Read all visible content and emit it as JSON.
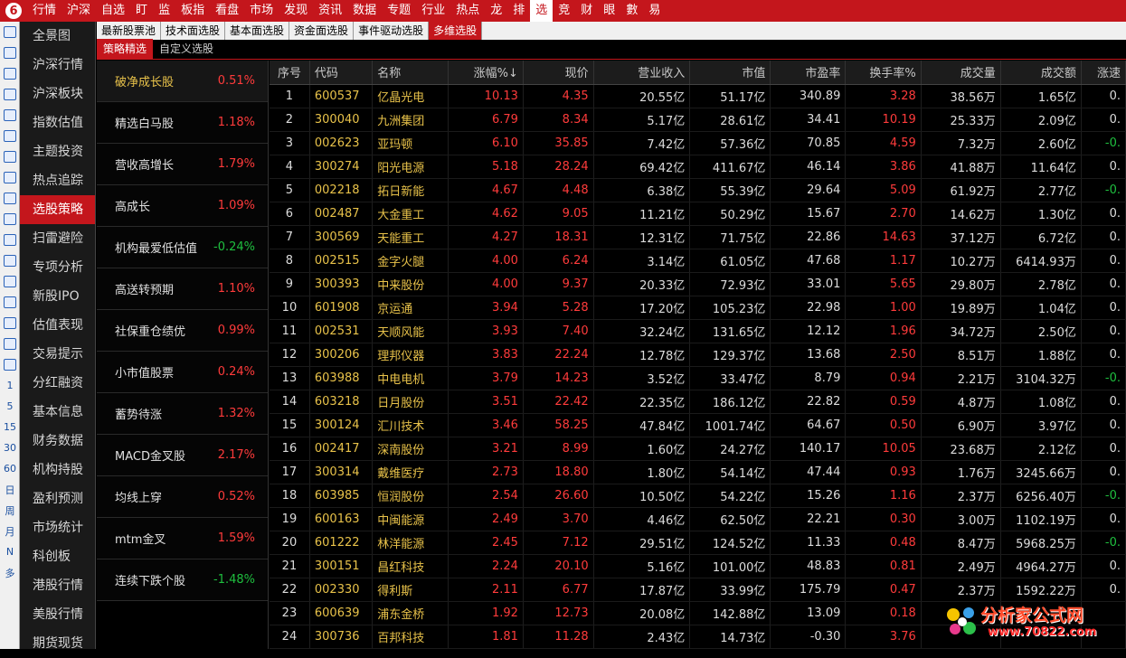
{
  "topnav": [
    "行情",
    "沪深",
    "自选",
    "盯",
    "监",
    "板指",
    "看盘",
    "市场",
    "发现",
    "资讯",
    "数据",
    "专题",
    "行业",
    "热点",
    "龙",
    "排",
    "选",
    "竞",
    "财",
    "眼",
    "數",
    "易"
  ],
  "topnav_active": 16,
  "left_icons": [
    "back-icon",
    "up-icon",
    "down-icon",
    "report-icon",
    "grid-icon",
    "chart-line-icon",
    "kline-icon",
    "fund-icon",
    "f10-icon",
    "news-icon",
    "f11-icon",
    "target-icon",
    "list-icon",
    "sort-icon",
    "export-icon",
    "pen-icon",
    "refresh-icon",
    "1",
    "5",
    "15",
    "30",
    "60",
    "日",
    "周",
    "月",
    "N",
    "多"
  ],
  "leftnav": [
    "全景图",
    "沪深行情",
    "沪深板块",
    "指数估值",
    "主题投资",
    "热点追踪",
    "选股策略",
    "扫雷避险",
    "专项分析",
    "新股IPO",
    "估值表现",
    "交易提示",
    "分红融资",
    "基本信息",
    "财务数据",
    "机构持股",
    "盈利预测",
    "市场统计",
    "科创板",
    "港股行情",
    "美股行情",
    "期货现货"
  ],
  "leftnav_active": 6,
  "subtabs1": [
    "最新股票池",
    "技术面选股",
    "基本面选股",
    "资金面选股",
    "事件驱动选股",
    "多维选股"
  ],
  "subtabs1_active": 5,
  "subtabs2": [
    "策略精选",
    "自定义选股"
  ],
  "subtabs2_active": 0,
  "strategies": [
    {
      "name": "破净成长股",
      "pct": "0.51%",
      "dir": "up"
    },
    {
      "name": "精选白马股",
      "pct": "1.18%",
      "dir": "up"
    },
    {
      "name": "营收高增长",
      "pct": "1.79%",
      "dir": "up"
    },
    {
      "name": "高成长",
      "pct": "1.09%",
      "dir": "up"
    },
    {
      "name": "机构最爱低估值",
      "pct": "-0.24%",
      "dir": "down"
    },
    {
      "name": "高送转预期",
      "pct": "1.10%",
      "dir": "up"
    },
    {
      "name": "社保重仓绩优",
      "pct": "0.99%",
      "dir": "up"
    },
    {
      "name": "小市值股票",
      "pct": "0.24%",
      "dir": "up"
    },
    {
      "name": "蓄势待涨",
      "pct": "1.32%",
      "dir": "up"
    },
    {
      "name": "MACD金叉股",
      "pct": "2.17%",
      "dir": "up"
    },
    {
      "name": "均线上穿",
      "pct": "0.52%",
      "dir": "up"
    },
    {
      "name": "mtm金叉",
      "pct": "1.59%",
      "dir": "up"
    },
    {
      "name": "连续下跌个股",
      "pct": "-1.48%",
      "dir": "down"
    }
  ],
  "strategies_active": 0,
  "table": {
    "headers": [
      "序号",
      "代码",
      "名称",
      "涨幅%↓",
      "现价",
      "营业收入",
      "市值",
      "市盈率",
      "换手率%",
      "成交量",
      "成交额",
      "涨速"
    ],
    "rows": [
      [
        "1",
        "600537",
        "亿晶光电",
        "10.13",
        "4.35",
        "20.55亿",
        "51.17亿",
        "340.89",
        "3.28",
        "38.56万",
        "1.65亿",
        "0."
      ],
      [
        "2",
        "300040",
        "九洲集团",
        "6.79",
        "8.34",
        "5.17亿",
        "28.61亿",
        "34.41",
        "10.19",
        "25.33万",
        "2.09亿",
        "0."
      ],
      [
        "3",
        "002623",
        "亚玛顿",
        "6.10",
        "35.85",
        "7.42亿",
        "57.36亿",
        "70.85",
        "4.59",
        "7.32万",
        "2.60亿",
        "-0."
      ],
      [
        "4",
        "300274",
        "阳光电源",
        "5.18",
        "28.24",
        "69.42亿",
        "411.67亿",
        "46.14",
        "3.86",
        "41.88万",
        "11.64亿",
        "0."
      ],
      [
        "5",
        "002218",
        "拓日新能",
        "4.67",
        "4.48",
        "6.38亿",
        "55.39亿",
        "29.64",
        "5.09",
        "61.92万",
        "2.77亿",
        "-0."
      ],
      [
        "6",
        "002487",
        "大金重工",
        "4.62",
        "9.05",
        "11.21亿",
        "50.29亿",
        "15.67",
        "2.70",
        "14.62万",
        "1.30亿",
        "0."
      ],
      [
        "7",
        "300569",
        "天能重工",
        "4.27",
        "18.31",
        "12.31亿",
        "71.75亿",
        "22.86",
        "14.63",
        "37.12万",
        "6.72亿",
        "0."
      ],
      [
        "8",
        "002515",
        "金字火腿",
        "4.00",
        "6.24",
        "3.14亿",
        "61.05亿",
        "47.68",
        "1.17",
        "10.27万",
        "6414.93万",
        "0."
      ],
      [
        "9",
        "300393",
        "中来股份",
        "4.00",
        "9.37",
        "20.33亿",
        "72.93亿",
        "33.01",
        "5.65",
        "29.80万",
        "2.78亿",
        "0."
      ],
      [
        "10",
        "601908",
        "京运通",
        "3.94",
        "5.28",
        "17.20亿",
        "105.23亿",
        "22.98",
        "1.00",
        "19.89万",
        "1.04亿",
        "0."
      ],
      [
        "11",
        "002531",
        "天顺风能",
        "3.93",
        "7.40",
        "32.24亿",
        "131.65亿",
        "12.12",
        "1.96",
        "34.72万",
        "2.50亿",
        "0."
      ],
      [
        "12",
        "300206",
        "理邦仪器",
        "3.83",
        "22.24",
        "12.78亿",
        "129.37亿",
        "13.68",
        "2.50",
        "8.51万",
        "1.88亿",
        "0."
      ],
      [
        "13",
        "603988",
        "中电电机",
        "3.79",
        "14.23",
        "3.52亿",
        "33.47亿",
        "8.79",
        "0.94",
        "2.21万",
        "3104.32万",
        "-0."
      ],
      [
        "14",
        "603218",
        "日月股份",
        "3.51",
        "22.42",
        "22.35亿",
        "186.12亿",
        "22.82",
        "0.59",
        "4.87万",
        "1.08亿",
        "0."
      ],
      [
        "15",
        "300124",
        "汇川技术",
        "3.46",
        "58.25",
        "47.84亿",
        "1001.74亿",
        "64.67",
        "0.50",
        "6.90万",
        "3.97亿",
        "0."
      ],
      [
        "16",
        "002417",
        "深南股份",
        "3.21",
        "8.99",
        "1.60亿",
        "24.27亿",
        "140.17",
        "10.05",
        "23.68万",
        "2.12亿",
        "0."
      ],
      [
        "17",
        "300314",
        "戴维医疗",
        "2.73",
        "18.80",
        "1.80亿",
        "54.14亿",
        "47.44",
        "0.93",
        "1.76万",
        "3245.66万",
        "0."
      ],
      [
        "18",
        "603985",
        "恒润股份",
        "2.54",
        "26.60",
        "10.50亿",
        "54.22亿",
        "15.26",
        "1.16",
        "2.37万",
        "6256.40万",
        "-0."
      ],
      [
        "19",
        "600163",
        "中闽能源",
        "2.49",
        "3.70",
        "4.46亿",
        "62.50亿",
        "22.21",
        "0.30",
        "3.00万",
        "1102.19万",
        "0."
      ],
      [
        "20",
        "601222",
        "林洋能源",
        "2.45",
        "7.12",
        "29.51亿",
        "124.52亿",
        "11.33",
        "0.48",
        "8.47万",
        "5968.25万",
        "-0."
      ],
      [
        "21",
        "300151",
        "昌红科技",
        "2.24",
        "20.10",
        "5.16亿",
        "101.00亿",
        "48.83",
        "0.81",
        "2.49万",
        "4964.27万",
        "0."
      ],
      [
        "22",
        "002330",
        "得利斯",
        "2.11",
        "6.77",
        "17.87亿",
        "33.99亿",
        "175.79",
        "0.47",
        "2.37万",
        "1592.22万",
        "0."
      ],
      [
        "23",
        "600639",
        "浦东金桥",
        "1.92",
        "12.73",
        "20.08亿",
        "142.88亿",
        "13.09",
        "0.18",
        "",
        "",
        " "
      ],
      [
        "24",
        "300736",
        "百邦科技",
        "1.81",
        "11.28",
        "2.43亿",
        "14.73亿",
        "-0.30",
        "3.76",
        "",
        "",
        " "
      ]
    ]
  },
  "colors": {
    "accent": "#c4161c",
    "up": "#ff3b3b",
    "down": "#1fbf3f",
    "code": "#e8c24a"
  },
  "watermark": {
    "line1": "分析家公式网",
    "line2": "www.70822.com"
  }
}
